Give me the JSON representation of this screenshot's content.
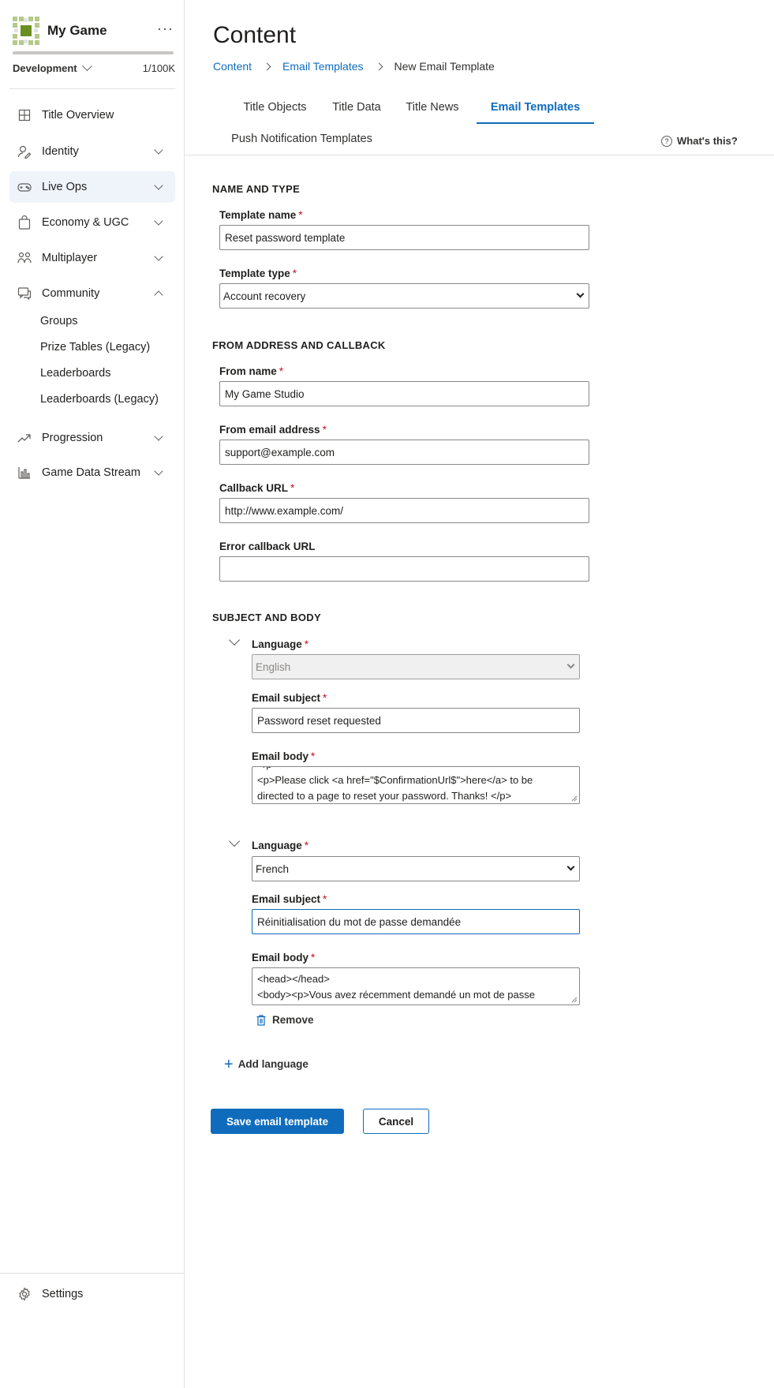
{
  "sidebar": {
    "game_title": "My Game",
    "more_label": "···",
    "environment": "Development",
    "usage_count": "1/100K",
    "usage_fraction": 0.01,
    "nav": [
      {
        "label": "Title Overview",
        "icon": "grid-icon"
      },
      {
        "label": "Identity",
        "icon": "identity-icon"
      },
      {
        "label": "Live Ops",
        "icon": "gamepad-icon"
      },
      {
        "label": "Economy & UGC",
        "icon": "shopping-bag-icon"
      },
      {
        "label": "Multiplayer",
        "icon": "multiplayer-icon"
      },
      {
        "label": "Community",
        "icon": "chat-icon"
      },
      {
        "label": "Progression",
        "icon": "trending-up-icon"
      },
      {
        "label": "Game Data Stream",
        "icon": "bar-chart-icon"
      }
    ],
    "community_items": [
      "Groups",
      "Prize Tables (Legacy)",
      "Leaderboards",
      "Leaderboards (Legacy)"
    ],
    "settings_label": "Settings"
  },
  "page": {
    "title": "Content",
    "breadcrumb": [
      "Content",
      "Email Templates",
      "New Email Template"
    ]
  },
  "tabs": [
    "Title Objects",
    "Title Data",
    "Title News",
    "Email Templates",
    "Push Notification Templates"
  ],
  "whats_this": "What's this?",
  "form": {
    "section_name_type": "NAME AND TYPE",
    "template_name_label": "Template name",
    "template_name_value": "Reset password template",
    "template_type_label": "Template type",
    "template_type_value": "Account recovery",
    "section_from": "FROM ADDRESS AND CALLBACK",
    "from_name_label": "From name",
    "from_name_value": "My Game Studio",
    "from_email_label": "From email address",
    "from_email_value": "support@example.com",
    "callback_label": "Callback URL",
    "callback_value": "http://www.example.com/",
    "error_callback_label": "Error callback URL",
    "error_callback_value": "",
    "section_subject": "SUBJECT AND BODY",
    "languages": [
      {
        "language_label": "Language",
        "language_value": "English",
        "subject_label": "Email subject",
        "subject_value": "Password reset requested",
        "body_label": "Email body",
        "body_lines": [
          "</p>",
          "<p>Please click <a href=\"$ConfirmationUrl$\">here</a> to be",
          "directed to a page to reset your password. Thanks! </p>"
        ]
      },
      {
        "language_label": "Language",
        "language_value": "French",
        "subject_label": "Email subject",
        "subject_value": "Réinitialisation du mot de passe demandée",
        "body_label": "Email body",
        "body_lines": [
          "<head></head>",
          "<body><p>Vous avez récemment demandé un mot de passe"
        ]
      }
    ],
    "required_mark": "*",
    "remove_label": "Remove",
    "add_language_label": "Add language",
    "save_label": "Save email template",
    "cancel_label": "Cancel"
  },
  "colors": {
    "accent": "#0f6cbd",
    "required": "#c50f1f",
    "logo_green": "#7a9a3a"
  }
}
